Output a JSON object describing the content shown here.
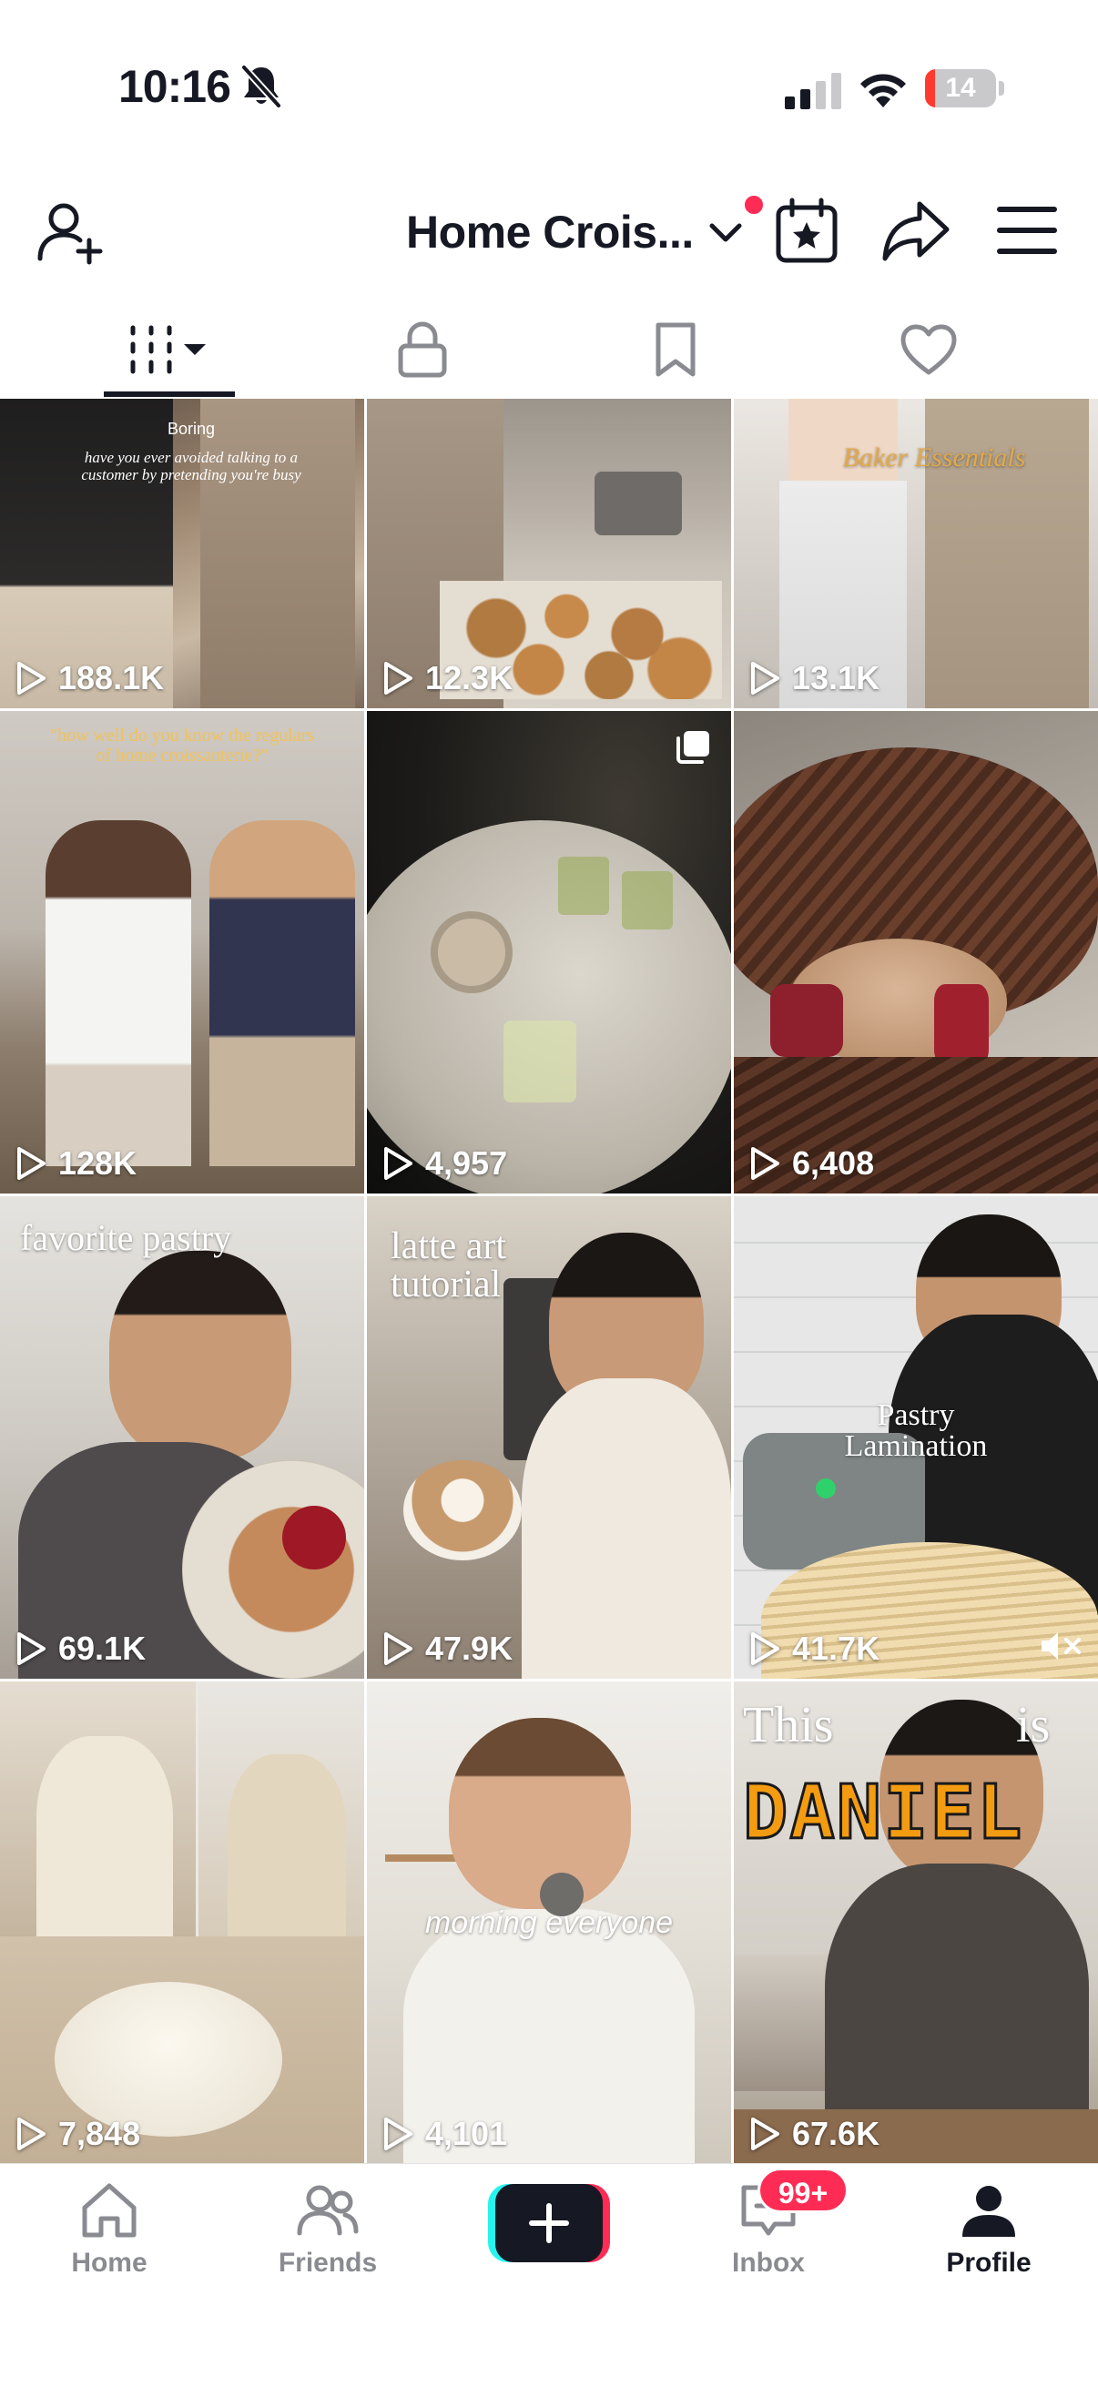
{
  "status_bar": {
    "time": "10:16",
    "battery": "14",
    "battery_fraction": 0.14,
    "silent_icon": "bell-slash-icon",
    "signal_icon": "cellular-signal-icon",
    "wifi_icon": "wifi-icon"
  },
  "header": {
    "title": "Home Crois...",
    "add_user_icon": "add-user-icon",
    "dropdown_icon": "chevron-down-icon",
    "calendar_icon": "calendar-star-icon",
    "share_icon": "share-arrow-icon",
    "menu_icon": "hamburger-menu-icon",
    "notification_dot_color": "#fe2c55"
  },
  "tabs": [
    {
      "name": "videos",
      "icon": "grid-icon",
      "active": true
    },
    {
      "name": "private",
      "icon": "lock-icon",
      "active": false
    },
    {
      "name": "favorites",
      "icon": "bookmark-icon",
      "active": false
    },
    {
      "name": "liked",
      "icon": "heart-icon",
      "active": false
    }
  ],
  "videos": [
    {
      "views": "188.1K",
      "overlay_title": "Boring",
      "overlay_caption": "have you ever avoided talking to a customer by pretending you're busy"
    },
    {
      "views": "12.3K"
    },
    {
      "views": "13.1K",
      "overlay_title": "Baker Essentials"
    },
    {
      "views": "128K",
      "overlay_title": "\"how well do you know the regulars of home croissanterie?\""
    },
    {
      "views": "4,957",
      "multi_icon": "multiple-photos-icon"
    },
    {
      "views": "6,408"
    },
    {
      "views": "69.1K",
      "overlay_title": "favorite pastry"
    },
    {
      "views": "47.9K",
      "overlay_title": "latte art tutorial"
    },
    {
      "views": "41.7K",
      "overlay_title": "Pastry Lamination",
      "muted_icon": "muted-speaker-icon"
    },
    {
      "views": "7,848"
    },
    {
      "views": "4,101",
      "overlay_title": "morning everyone"
    },
    {
      "views": "67.6K",
      "overlay_title_a": "This",
      "overlay_title_b": "is",
      "overlay_title_c": "DANIEL"
    }
  ],
  "bottom_nav": {
    "home": "Home",
    "friends": "Friends",
    "create_icon": "plus-icon",
    "inbox": "Inbox",
    "inbox_badge": "99+",
    "profile": "Profile"
  },
  "colors": {
    "accent_pink": "#fe2c55",
    "accent_cyan": "#25f4ee",
    "text_primary": "#161823",
    "text_inactive": "#8a8b91"
  }
}
